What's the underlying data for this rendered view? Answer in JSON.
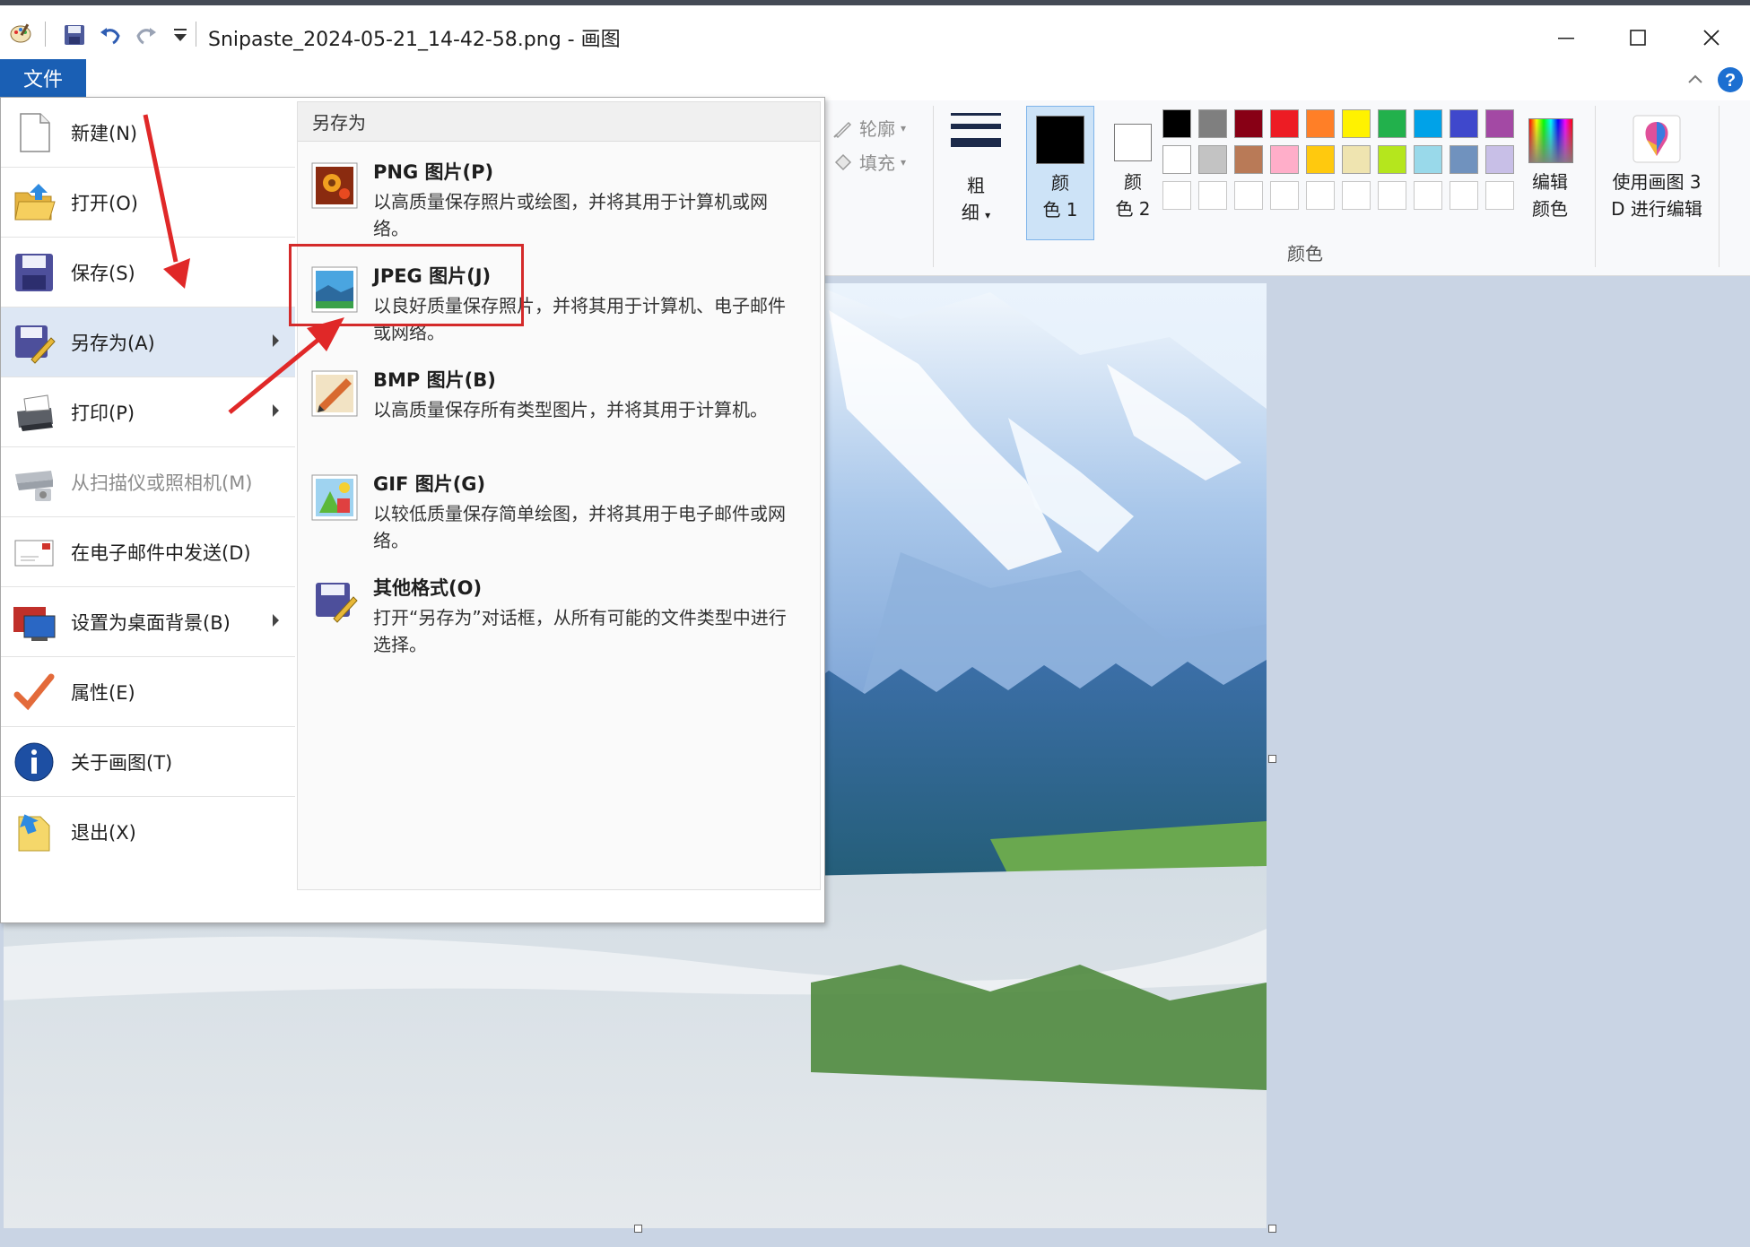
{
  "window": {
    "title": "Snipaste_2024-05-21_14-42-58.png - 画图"
  },
  "ribbon": {
    "file_tab_label": "文件",
    "outline_label": "轮廓",
    "fill_label": "填充",
    "size_label_1": "粗",
    "size_label_2": "细",
    "color1_label_1": "颜",
    "color1_label_2": "色 1",
    "color2_label_1": "颜",
    "color2_label_2": "色 2",
    "edit_colors_label_1": "编辑",
    "edit_colors_label_2": "颜色",
    "paint3d_label_1": "使用画图 3",
    "paint3d_label_2": "D 进行编辑",
    "colors_group_label": "颜色",
    "palette_row1": [
      "#000000",
      "#7f7f7f",
      "#880015",
      "#ed1c24",
      "#ff7f27",
      "#fff200",
      "#22b14c",
      "#00a2e8",
      "#3f48cc",
      "#a349a4"
    ],
    "palette_row2": [
      "#ffffff",
      "#c3c3c3",
      "#b97a57",
      "#ffaec9",
      "#ffc90e",
      "#efe4b0",
      "#b5e61d",
      "#99d9ea",
      "#7092be",
      "#c8bfe7"
    ],
    "color1": "#000000",
    "color2": "#ffffff"
  },
  "file_menu": {
    "items": [
      {
        "label": "新建(N)",
        "icon": "new-file-icon"
      },
      {
        "label": "打开(O)",
        "icon": "open-folder-icon"
      },
      {
        "label": "保存(S)",
        "icon": "save-disk-icon"
      },
      {
        "label": "另存为(A)",
        "icon": "save-as-icon"
      },
      {
        "label": "打印(P)",
        "icon": "printer-icon"
      },
      {
        "label": "从扫描仪或照相机(M)",
        "icon": "scanner-icon"
      },
      {
        "label": "在电子邮件中发送(D)",
        "icon": "email-icon"
      },
      {
        "label": "设置为桌面背景(B)",
        "icon": "desktop-background-icon"
      },
      {
        "label": "属性(E)",
        "icon": "checkmark-icon"
      },
      {
        "label": "关于画图(T)",
        "icon": "info-icon"
      },
      {
        "label": "退出(X)",
        "icon": "exit-icon"
      }
    ]
  },
  "save_as_menu": {
    "title": "另存为",
    "items": [
      {
        "title": "PNG 图片(P)",
        "desc": "以高质量保存照片或绘图，并将其用于计算机或网络。"
      },
      {
        "title": "JPEG 图片(J)",
        "desc": "以良好质量保存照片，并将其用于计算机、电子邮件或网络。"
      },
      {
        "title": "BMP 图片(B)",
        "desc": "以高质量保存所有类型图片，并将其用于计算机。"
      },
      {
        "title": "GIF 图片(G)",
        "desc": "以较低质量保存简单绘图，并将其用于电子邮件或网络。"
      },
      {
        "title": "其他格式(O)",
        "desc": "打开“另存为”对话框，从所有可能的文件类型中进行选择。"
      }
    ]
  },
  "annotations": {
    "color": "#d42a2a"
  }
}
